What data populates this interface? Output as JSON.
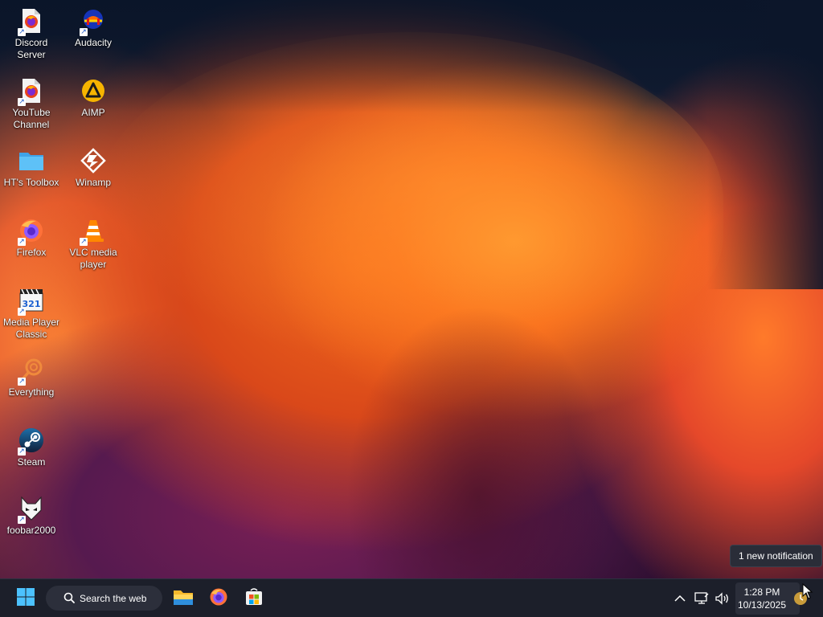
{
  "desktop": {
    "icons": [
      {
        "label": "Discord Server",
        "icon": "firefox-shortcut-icon"
      },
      {
        "label": "YouTube Channel",
        "icon": "firefox-shortcut-icon"
      },
      {
        "label": "HT's Toolbox",
        "icon": "folder-icon"
      },
      {
        "label": "Firefox",
        "icon": "firefox-icon"
      },
      {
        "label": "Media Player Classic",
        "icon": "media-player-classic-icon"
      },
      {
        "label": "Everything",
        "icon": "everything-search-icon"
      },
      {
        "label": "Steam",
        "icon": "steam-icon"
      },
      {
        "label": "foobar2000",
        "icon": "foobar2000-icon"
      },
      {
        "label": "Audacity",
        "icon": "audacity-icon"
      },
      {
        "label": "AIMP",
        "icon": "aimp-icon"
      },
      {
        "label": "Winamp",
        "icon": "winamp-icon"
      },
      {
        "label": "VLC media player",
        "icon": "vlc-icon"
      }
    ]
  },
  "taskbar": {
    "start_icon": "windows-start-icon",
    "search_placeholder": "Search the web",
    "pinned": [
      {
        "name": "File Explorer",
        "icon": "file-explorer-icon"
      },
      {
        "name": "Firefox",
        "icon": "firefox-icon"
      },
      {
        "name": "Microsoft Store",
        "icon": "microsoft-store-icon"
      }
    ],
    "tray": {
      "time": "1:28 PM",
      "date": "10/13/2025"
    }
  },
  "notification": {
    "text": "1 new notification"
  },
  "colors": {
    "taskbar_bg": "#1c1f2a",
    "accent": "#0078d4"
  }
}
